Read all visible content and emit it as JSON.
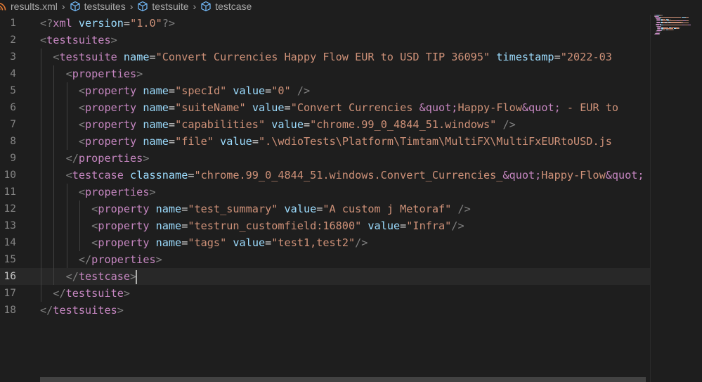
{
  "breadcrumb": {
    "file": "results.xml",
    "items": [
      "testsuites",
      "testsuite",
      "testcase"
    ]
  },
  "editor": {
    "current_line": 16,
    "lines": [
      {
        "n": "1",
        "tokens": [
          [
            "pun",
            "<?"
          ],
          [
            "tag",
            "xml"
          ],
          [
            "txt",
            " "
          ],
          [
            "attr",
            "version"
          ],
          [
            "eq",
            "="
          ],
          [
            "val",
            "\"1.0\""
          ],
          [
            "pun",
            "?>"
          ]
        ]
      },
      {
        "n": "2",
        "tokens": [
          [
            "pun",
            "<"
          ],
          [
            "tag",
            "testsuites"
          ],
          [
            "pun",
            ">"
          ]
        ]
      },
      {
        "n": "3",
        "tokens": [
          [
            "txt",
            "  "
          ],
          [
            "pun",
            "<"
          ],
          [
            "tag",
            "testsuite"
          ],
          [
            "txt",
            " "
          ],
          [
            "attr",
            "name"
          ],
          [
            "eq",
            "="
          ],
          [
            "val",
            "\"Convert Currencies Happy Flow EUR to USD TIP 36095\""
          ],
          [
            "txt",
            " "
          ],
          [
            "attr",
            "timestamp"
          ],
          [
            "eq",
            "="
          ],
          [
            "val",
            "\"2022-03"
          ]
        ]
      },
      {
        "n": "4",
        "tokens": [
          [
            "txt",
            "    "
          ],
          [
            "pun",
            "<"
          ],
          [
            "tag",
            "properties"
          ],
          [
            "pun",
            ">"
          ]
        ]
      },
      {
        "n": "5",
        "tokens": [
          [
            "txt",
            "      "
          ],
          [
            "pun",
            "<"
          ],
          [
            "tag",
            "property"
          ],
          [
            "txt",
            " "
          ],
          [
            "attr",
            "name"
          ],
          [
            "eq",
            "="
          ],
          [
            "val",
            "\"specId\""
          ],
          [
            "txt",
            " "
          ],
          [
            "attr",
            "value"
          ],
          [
            "eq",
            "="
          ],
          [
            "val",
            "\"0\""
          ],
          [
            "txt",
            " "
          ],
          [
            "pun",
            "/>"
          ]
        ]
      },
      {
        "n": "6",
        "tokens": [
          [
            "txt",
            "      "
          ],
          [
            "pun",
            "<"
          ],
          [
            "tag",
            "property"
          ],
          [
            "txt",
            " "
          ],
          [
            "attr",
            "name"
          ],
          [
            "eq",
            "="
          ],
          [
            "val",
            "\"suiteName\""
          ],
          [
            "txt",
            " "
          ],
          [
            "attr",
            "value"
          ],
          [
            "eq",
            "="
          ],
          [
            "val",
            "\"Convert Currencies "
          ],
          [
            "ent",
            "&quot;"
          ],
          [
            "val",
            "Happy-Flow"
          ],
          [
            "ent",
            "&quot;"
          ],
          [
            "val",
            " - EUR to"
          ]
        ]
      },
      {
        "n": "7",
        "tokens": [
          [
            "txt",
            "      "
          ],
          [
            "pun",
            "<"
          ],
          [
            "tag",
            "property"
          ],
          [
            "txt",
            " "
          ],
          [
            "attr",
            "name"
          ],
          [
            "eq",
            "="
          ],
          [
            "val",
            "\"capabilities\""
          ],
          [
            "txt",
            " "
          ],
          [
            "attr",
            "value"
          ],
          [
            "eq",
            "="
          ],
          [
            "val",
            "\"chrome.99_0_4844_51.windows\""
          ],
          [
            "txt",
            " "
          ],
          [
            "pun",
            "/>"
          ]
        ]
      },
      {
        "n": "8",
        "tokens": [
          [
            "txt",
            "      "
          ],
          [
            "pun",
            "<"
          ],
          [
            "tag",
            "property"
          ],
          [
            "txt",
            " "
          ],
          [
            "attr",
            "name"
          ],
          [
            "eq",
            "="
          ],
          [
            "val",
            "\"file\""
          ],
          [
            "txt",
            " "
          ],
          [
            "attr",
            "value"
          ],
          [
            "eq",
            "="
          ],
          [
            "val",
            "\".\\wdioTests\\Platform\\Timtam\\MultiFX\\MultiFxEURtoUSD.js"
          ]
        ]
      },
      {
        "n": "9",
        "tokens": [
          [
            "txt",
            "    "
          ],
          [
            "pun",
            "</"
          ],
          [
            "tag",
            "properties"
          ],
          [
            "pun",
            ">"
          ]
        ]
      },
      {
        "n": "10",
        "tokens": [
          [
            "txt",
            "    "
          ],
          [
            "pun",
            "<"
          ],
          [
            "tag",
            "testcase"
          ],
          [
            "txt",
            " "
          ],
          [
            "attr",
            "classname"
          ],
          [
            "eq",
            "="
          ],
          [
            "val",
            "\"chrome.99_0_4844_51.windows.Convert_Currencies_"
          ],
          [
            "ent",
            "&quot;"
          ],
          [
            "val",
            "Happy-Flow"
          ],
          [
            "ent",
            "&quot;"
          ]
        ]
      },
      {
        "n": "11",
        "tokens": [
          [
            "txt",
            "      "
          ],
          [
            "pun",
            "<"
          ],
          [
            "tag",
            "properties"
          ],
          [
            "pun",
            ">"
          ]
        ]
      },
      {
        "n": "12",
        "tokens": [
          [
            "txt",
            "        "
          ],
          [
            "pun",
            "<"
          ],
          [
            "tag",
            "property"
          ],
          [
            "txt",
            " "
          ],
          [
            "attr",
            "name"
          ],
          [
            "eq",
            "="
          ],
          [
            "val",
            "\"test_summary\""
          ],
          [
            "txt",
            " "
          ],
          [
            "attr",
            "value"
          ],
          [
            "eq",
            "="
          ],
          [
            "val",
            "\"A custom j Metoraf\""
          ],
          [
            "txt",
            " "
          ],
          [
            "pun",
            "/>"
          ]
        ]
      },
      {
        "n": "13",
        "tokens": [
          [
            "txt",
            "        "
          ],
          [
            "pun",
            "<"
          ],
          [
            "tag",
            "property"
          ],
          [
            "txt",
            " "
          ],
          [
            "attr",
            "name"
          ],
          [
            "eq",
            "="
          ],
          [
            "val",
            "\"testrun_customfield:16800\""
          ],
          [
            "txt",
            " "
          ],
          [
            "attr",
            "value"
          ],
          [
            "eq",
            "="
          ],
          [
            "val",
            "\"Infra\""
          ],
          [
            "pun",
            "/>"
          ]
        ]
      },
      {
        "n": "14",
        "tokens": [
          [
            "txt",
            "        "
          ],
          [
            "pun",
            "<"
          ],
          [
            "tag",
            "property"
          ],
          [
            "txt",
            " "
          ],
          [
            "attr",
            "name"
          ],
          [
            "eq",
            "="
          ],
          [
            "val",
            "\"tags\""
          ],
          [
            "txt",
            " "
          ],
          [
            "attr",
            "value"
          ],
          [
            "eq",
            "="
          ],
          [
            "val",
            "\"test1,test2\""
          ],
          [
            "pun",
            "/>"
          ]
        ]
      },
      {
        "n": "15",
        "tokens": [
          [
            "txt",
            "      "
          ],
          [
            "pun",
            "</"
          ],
          [
            "tag",
            "properties"
          ],
          [
            "pun",
            ">"
          ]
        ]
      },
      {
        "n": "16",
        "tokens": [
          [
            "txt",
            "    "
          ],
          [
            "pun",
            "</"
          ],
          [
            "tag",
            "testcase"
          ],
          [
            "pun",
            ">"
          ],
          [
            "cursor",
            ""
          ]
        ]
      },
      {
        "n": "17",
        "tokens": [
          [
            "txt",
            "  "
          ],
          [
            "pun",
            "</"
          ],
          [
            "tag",
            "testsuite"
          ],
          [
            "pun",
            ">"
          ]
        ]
      },
      {
        "n": "18",
        "tokens": [
          [
            "pun",
            "</"
          ],
          [
            "tag",
            "testsuites"
          ],
          [
            "pun",
            ">"
          ]
        ]
      }
    ]
  },
  "colors": {
    "background": "#1e1e1e",
    "tag": "#c586c0",
    "attribute": "#9cdcfe",
    "string": "#ce9178",
    "punctuation": "#808080",
    "line_number": "#858585",
    "current_line": "#282828"
  }
}
